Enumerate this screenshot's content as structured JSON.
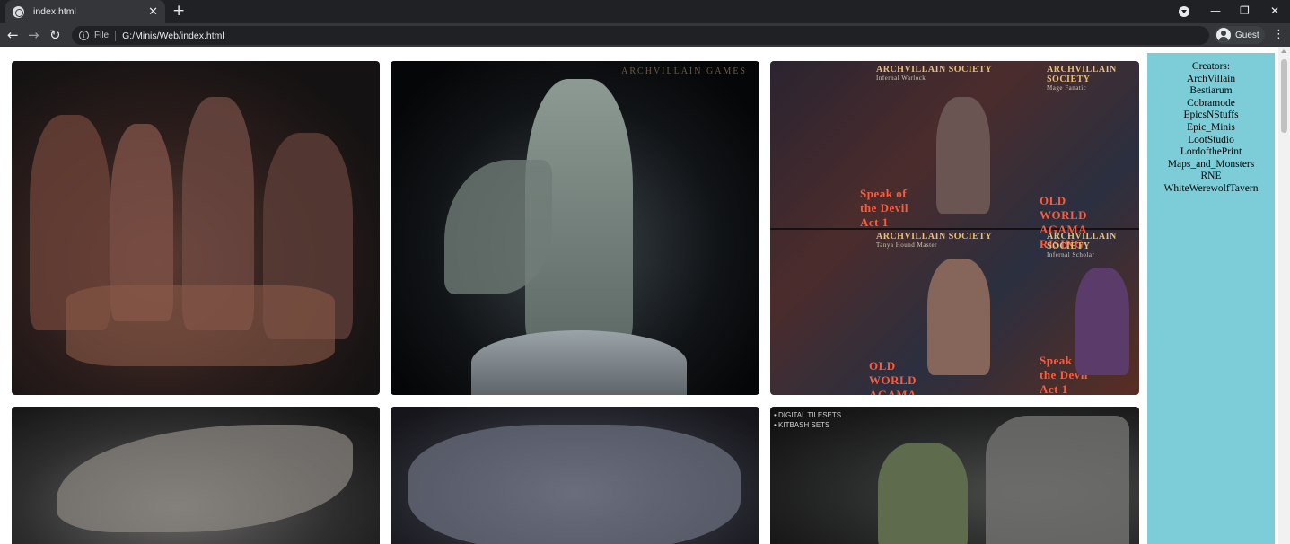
{
  "browser": {
    "tab_title": "index.html",
    "tab_close": "✕",
    "new_tab": "+",
    "minimize": "—",
    "restore": "❐",
    "close": "✕",
    "back": "←",
    "forward": "→",
    "reload": "↻",
    "info_glyph": "i",
    "scheme": "File",
    "url": "G:/Minis/Web/index.html",
    "profile_name": "Guest",
    "menu": "⋮"
  },
  "sidebar": {
    "heading": "Creators:",
    "creators": [
      "ArchVillain",
      "Bestiarum",
      "Cobramode",
      "EpicsNStuffs",
      "Epic_Minis",
      "LootStudio",
      "LordofthePrint",
      "Maps_and_Monsters",
      "RNE",
      "WhiteWerewolfTavern"
    ]
  },
  "gallery": {
    "card2_watermark": "ARCHVILLAIN GAMES",
    "card3_labels": [
      {
        "title": "ARCHVILLAIN SOCIETY",
        "sub": "Infernal Warlock"
      },
      {
        "title": "ARCHVILLAIN SOCIETY",
        "sub": "Mage Fanatic"
      },
      {
        "title": "Speak of the Devil Act 1",
        "sub": ""
      },
      {
        "title": "OLD WORLD AGAMA RISING",
        "sub": ""
      },
      {
        "title": "ARCHVILLAIN SOCIETY",
        "sub": "Tanya Hound Master"
      },
      {
        "title": "ARCHVILLAIN SOCIETY",
        "sub": "Infernal Scholar"
      },
      {
        "title": "OLD WORLD AGAMA RISING",
        "sub": ""
      },
      {
        "title": "Speak of the Devil Act 1",
        "sub": ""
      }
    ],
    "card6_lines": [
      "• DIGITAL TILESETS",
      "• KITBASH SETS"
    ]
  }
}
